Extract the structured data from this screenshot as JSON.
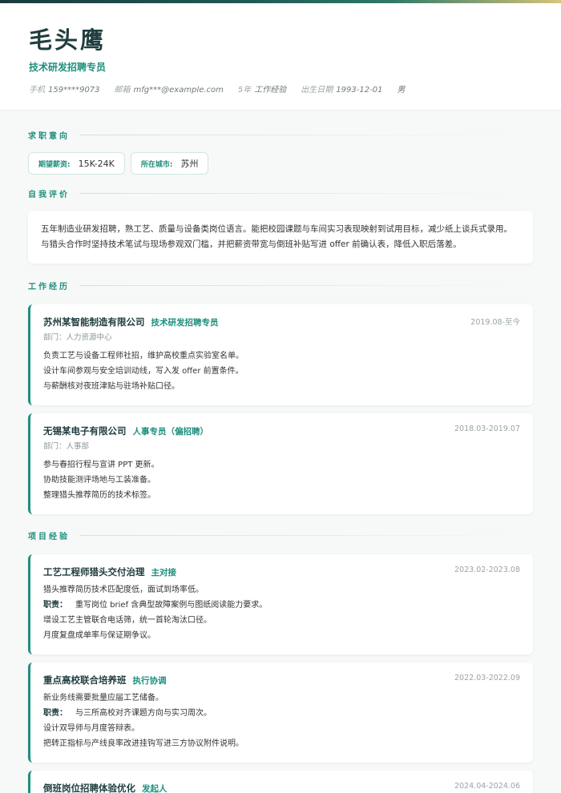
{
  "header": {
    "name": "毛头鹰",
    "title": "技术研发招聘专员",
    "meta": [
      {
        "label": "手机",
        "value": "159****9073"
      },
      {
        "label": "邮箱",
        "value": "mfg***@example.com"
      },
      {
        "label": "5年",
        "value": "工作经验"
      },
      {
        "label": "出生日期",
        "value": "1993-12-01"
      },
      {
        "label": "",
        "value": "男"
      }
    ]
  },
  "sections": {
    "intent": "求职意向",
    "summary": "自我评价",
    "work": "工作经历",
    "projects": "项目经验"
  },
  "intent": {
    "salary_label": "期望薪资:",
    "salary_value": "15K-24K",
    "city_label": "所在城市:",
    "city_value": "苏州"
  },
  "summary": {
    "line1": "五年制造业研发招聘，熟工艺、质量与设备类岗位语言。能把校园课题与车间实习表现映射到试用目标，减少纸上谈兵式录用。",
    "line2": "与猎头合作时坚持技术笔试与现场参观双门槛，并把薪资带宽与倒班补贴写进 offer 前确认表，降低入职后落差。"
  },
  "work": [
    {
      "company": "苏州某智能制造有限公司",
      "role": "技术研发招聘专员",
      "date": "2019.08-至今",
      "dept": "部门：人力资源中心",
      "lines": [
        "负责工艺与设备工程师社招，维护高校重点实验室名单。",
        "设计车间参观与安全培训动线，写入发 offer 前置条件。",
        "与薪酬核对夜班津贴与驻场补贴口径。"
      ]
    },
    {
      "company": "无锡某电子有限公司",
      "role": "人事专员（偏招聘）",
      "date": "2018.03-2019.07",
      "dept": "部门：人事部",
      "lines": [
        "参与春招行程与宣讲 PPT 更新。",
        "协助技能测评场地与工装准备。",
        "整理猎头推荐简历的技术标签。"
      ]
    }
  ],
  "projects": [
    {
      "name": "工艺工程师猎头交付治理",
      "role": "主对接",
      "date": "2023.02-2023.08",
      "background": "猎头推荐简历技术匹配度低，面试到场率低。",
      "duty_label": "职责：",
      "duty": "重写岗位 brief 含典型故障案例与图纸阅读能力要求。",
      "lines": [
        "增设工艺主管联合电话筛，统一首轮淘汰口径。",
        "月度复盘成单率与保证期争议。"
      ]
    },
    {
      "name": "重点高校联合培养班",
      "role": "执行协调",
      "date": "2022.03-2022.09",
      "background": "新业务线需要批量应届工艺储备。",
      "duty_label": "职责：",
      "duty": "与三所高校对齐课题方向与实习周次。",
      "lines": [
        "设计双导师与月度答辩表。",
        "把转正指标与产线良率改进挂钩写进三方协议附件说明。"
      ]
    },
    {
      "name": "倒班岗位招聘体验优化",
      "role": "发起人",
      "date": "2024.04-2024.06"
    }
  ]
}
